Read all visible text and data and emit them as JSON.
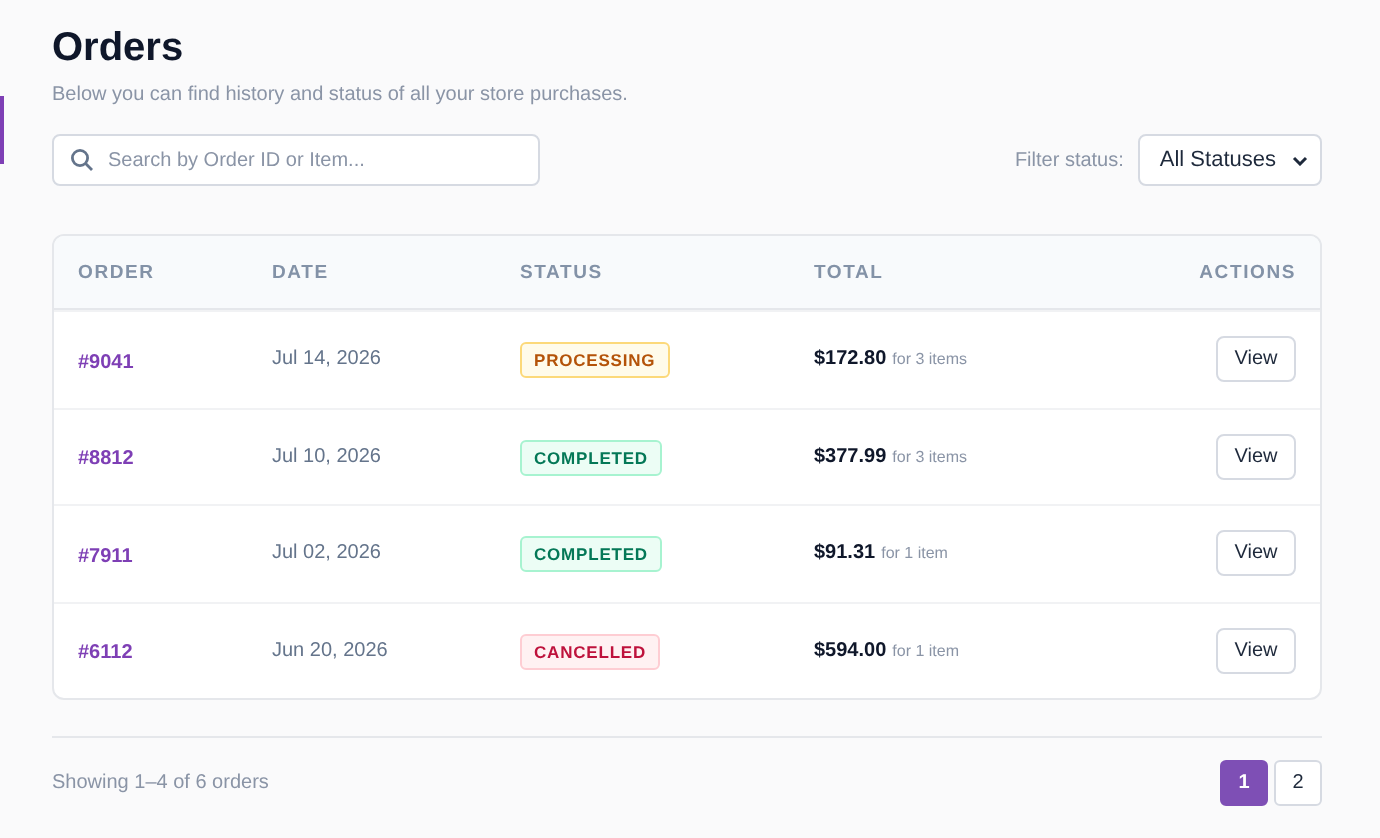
{
  "title": "Orders",
  "subtitle": "Below you can find history and status of all your store purchases.",
  "search": {
    "placeholder": "Search by Order ID or Item..."
  },
  "filter": {
    "label": "Filter status:",
    "value": "All Statuses"
  },
  "table": {
    "columns": [
      "ORDER",
      "DATE",
      "STATUS",
      "TOTAL",
      "ACTIONS"
    ],
    "rows": [
      {
        "order": "#9041",
        "date": "Jul 14, 2026",
        "status": {
          "label": "PROCESSING",
          "kind": "processing"
        },
        "total": "$172.80",
        "items": "for 3 items",
        "action": "View"
      },
      {
        "order": "#8812",
        "date": "Jul 10, 2026",
        "status": {
          "label": "COMPLETED",
          "kind": "completed"
        },
        "total": "$377.99",
        "items": "for 3 items",
        "action": "View"
      },
      {
        "order": "#7911",
        "date": "Jul 02, 2026",
        "status": {
          "label": "COMPLETED",
          "kind": "completed"
        },
        "total": "$91.31",
        "items": "for 1 item",
        "action": "View"
      },
      {
        "order": "#6112",
        "date": "Jun 20, 2026",
        "status": {
          "label": "CANCELLED",
          "kind": "cancelled"
        },
        "total": "$594.00",
        "items": "for 1 item",
        "action": "View"
      }
    ]
  },
  "footer": {
    "summary": "Showing 1–4 of 6 orders",
    "pages": [
      {
        "label": "1",
        "selected": true
      },
      {
        "label": "2",
        "selected": false
      }
    ]
  }
}
